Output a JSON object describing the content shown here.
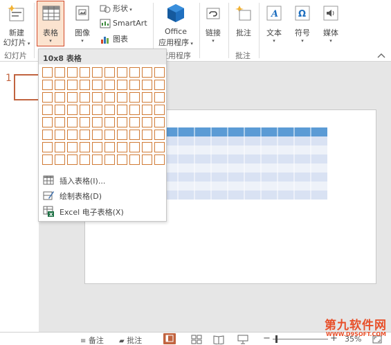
{
  "ribbon": {
    "new_slide": {
      "line1": "新建",
      "line2": "幻灯片"
    },
    "table": {
      "label": "表格"
    },
    "images": {
      "label": "图像"
    },
    "shapes": {
      "label": "形状"
    },
    "smartart": {
      "label": "SmartArt"
    },
    "chart": {
      "label": "图表"
    },
    "office_apps": {
      "line1": "Office",
      "line2": "应用程序"
    },
    "links": {
      "label": "链接"
    },
    "comment": {
      "label": "批注"
    },
    "text": {
      "label": "文本"
    },
    "symbols": {
      "label": "符号"
    },
    "media": {
      "label": "媒体"
    },
    "groups": {
      "slides": "幻灯片",
      "apps": "应用程序",
      "comments": "批注"
    },
    "collapse_icon": "chevron-up-icon"
  },
  "thumbnails": {
    "first_number": "1"
  },
  "table_dropdown": {
    "grid_label": "10x8 表格",
    "grid_cols": 10,
    "grid_rows": 8,
    "items": [
      {
        "label": "插入表格(I)...",
        "icon": "insert-table-icon"
      },
      {
        "label": "绘制表格(D)",
        "icon": "draw-table-icon"
      },
      {
        "label": "Excel 电子表格(X)",
        "icon": "excel-spreadsheet-icon"
      }
    ]
  },
  "preview_table": {
    "header_color": "#5b9bd5",
    "band_color": "#d9e2f3",
    "rows": 8,
    "cols": 10
  },
  "statusbar": {
    "notes": "备注",
    "comments": "批注",
    "zoom_percent": "35%",
    "zoom_minus": "−",
    "zoom_plus": "+"
  },
  "watermark": {
    "brand": "第九软件网",
    "url": "WWW.D9SOFT.COM"
  },
  "colors": {
    "accent": "#c1633f",
    "grid_border": "#d07a34",
    "ppt_orange": "#d24726",
    "status_accent": "#c1633f"
  }
}
